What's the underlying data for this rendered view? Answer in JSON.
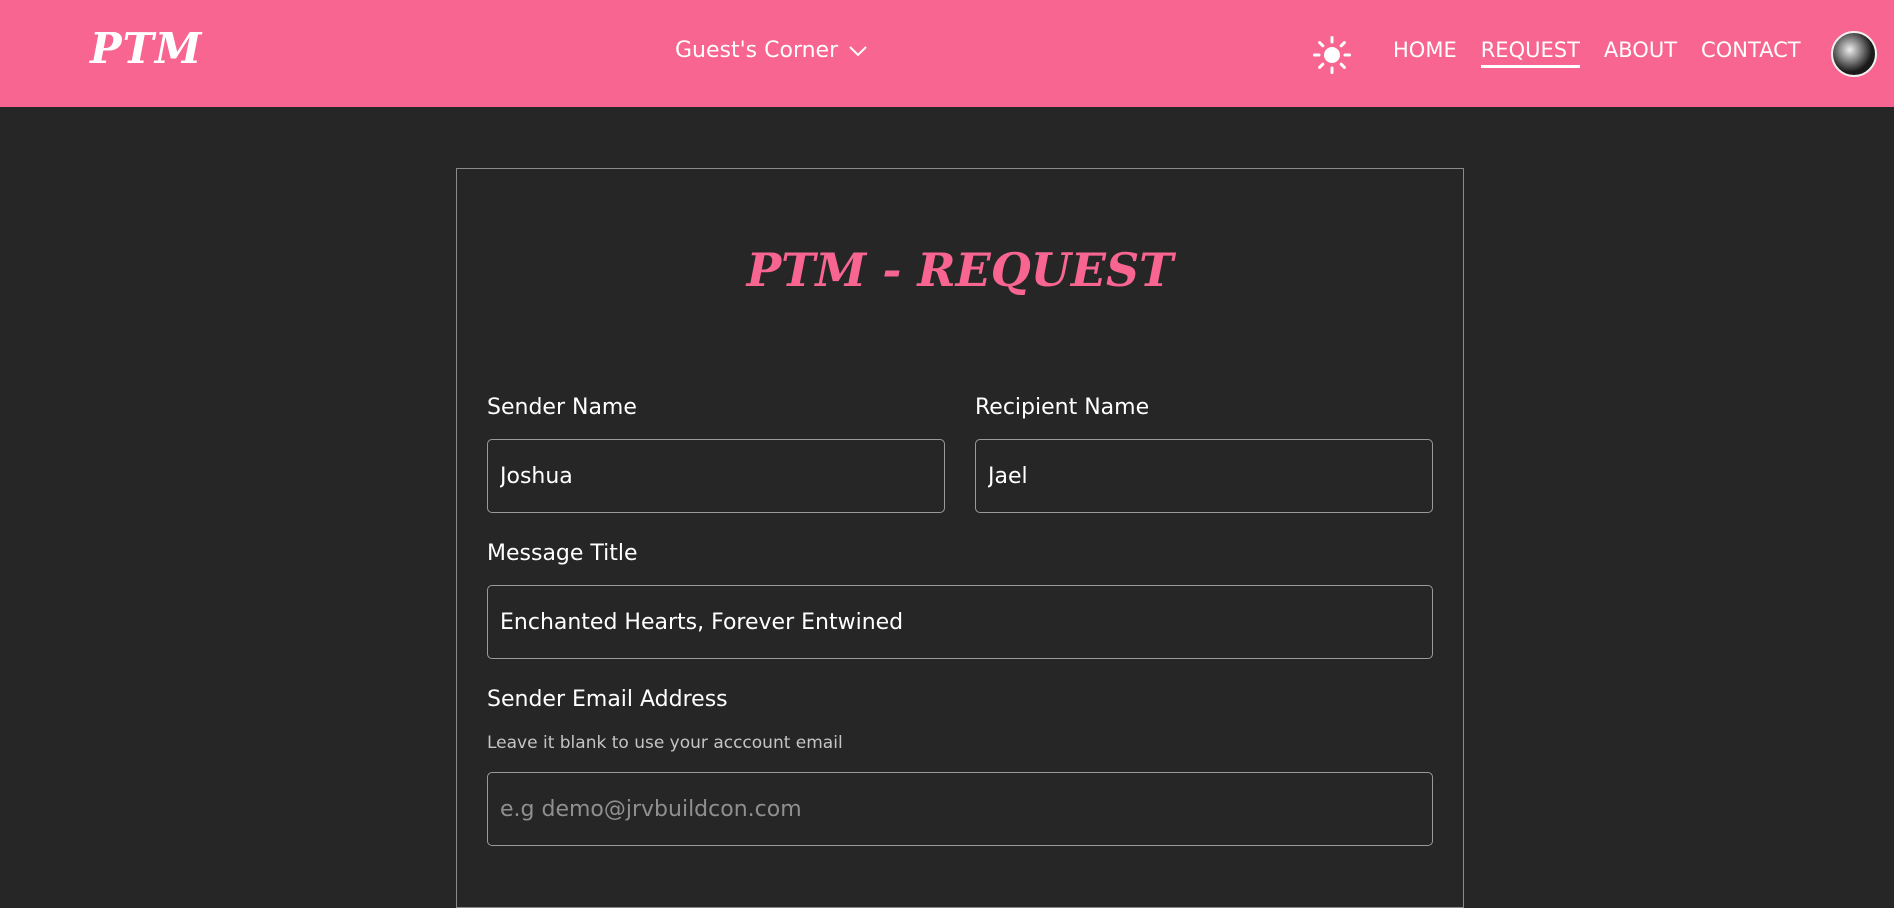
{
  "navbar": {
    "brand": "PTM",
    "dropdown_label": "Guest's Corner",
    "links": [
      {
        "label": "HOME",
        "active": false
      },
      {
        "label": "REQUEST",
        "active": true
      },
      {
        "label": "ABOUT",
        "active": false
      },
      {
        "label": "CONTACT",
        "active": false
      }
    ],
    "icons": [
      "chevron-down-icon",
      "sun-icon",
      "avatar"
    ]
  },
  "form": {
    "title": "PTM - REQUEST",
    "sender_name": {
      "label": "Sender Name",
      "value": "Joshua"
    },
    "recipient_name": {
      "label": "Recipient Name",
      "value": "Jael"
    },
    "message_title": {
      "label": "Message Title",
      "value": "Enchanted Hearts, Forever Entwined"
    },
    "sender_email": {
      "label": "Sender Email Address",
      "hint": "Leave it blank to use your acccount email",
      "value": "",
      "placeholder": "e.g demo@jrvbuildcon.com"
    }
  },
  "colors": {
    "accent": "#f76590",
    "background": "#262626",
    "text": "#ffffff",
    "border": "#9a9a9a"
  }
}
